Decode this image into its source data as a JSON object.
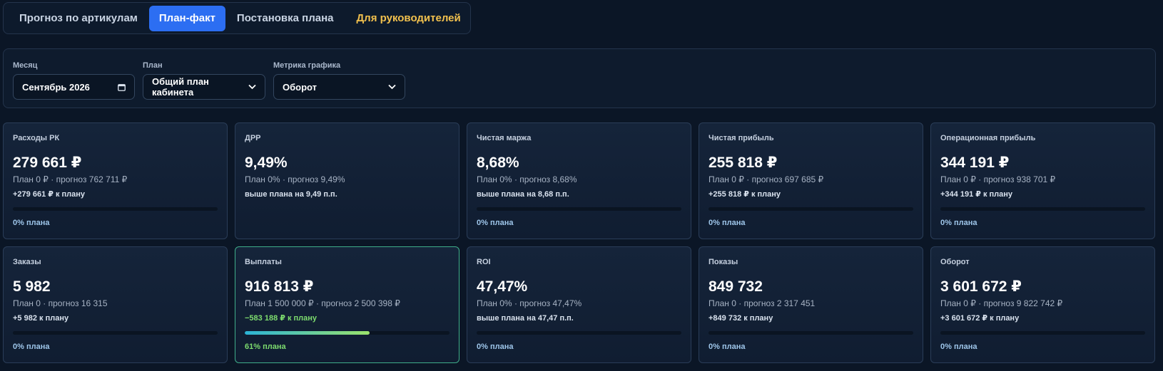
{
  "tabs": [
    {
      "label": "Прогноз по артикулам"
    },
    {
      "label": "План-факт"
    },
    {
      "label": "Постановка плана"
    },
    {
      "label": "Для руководителей"
    }
  ],
  "colors": {
    "active_tab": "#2c6ef2",
    "accent_tab": "#f2c14e",
    "positive": "#7ddc6e"
  },
  "filters": {
    "month": {
      "label": "Месяц",
      "value": "Сентябрь 2026",
      "icon": "calendar-icon"
    },
    "plan": {
      "label": "План",
      "value": "Общий план кабинета",
      "icon": "chevron-down-icon"
    },
    "metric": {
      "label": "Метрика графика",
      "value": "Оборот",
      "icon": "chevron-down-icon"
    }
  },
  "cards": [
    {
      "title": "Расходы РК",
      "value": "279 661 ₽",
      "sub": "План 0 ₽ · прогноз 762 711 ₽",
      "delta": "+279 661 ₽ к плану",
      "pct": "0% плана",
      "progress": 0
    },
    {
      "title": "ДРР",
      "value": "9,49%",
      "sub": "План 0% · прогноз 9,49%",
      "delta": "выше плана на 9,49 п.п."
    },
    {
      "title": "Чистая маржа",
      "value": "8,68%",
      "sub": "План 0% · прогноз 8,68%",
      "delta": "выше плана на 8,68 п.п.",
      "pct": "0% плана",
      "progress": 0
    },
    {
      "title": "Чистая прибыль",
      "value": "255 818 ₽",
      "sub": "План 0 ₽ · прогноз 697 685 ₽",
      "delta": "+255 818 ₽ к плану",
      "pct": "0% плана",
      "progress": 0
    },
    {
      "title": "Операционная прибыль",
      "value": "344 191 ₽",
      "sub": "План 0 ₽ · прогноз 938 701 ₽",
      "delta": "+344 191 ₽ к плану",
      "pct": "0% плана",
      "progress": 0
    },
    {
      "title": "Заказы",
      "value": "5 982",
      "sub": "План 0 · прогноз 16 315",
      "delta": "+5 982 к плану",
      "pct": "0% плана",
      "progress": 0
    },
    {
      "title": "Выплаты",
      "value": "916 813 ₽",
      "sub": "План 1 500 000 ₽ · прогноз 2 500 398 ₽",
      "delta": "−583 188 ₽ к плану",
      "pct": "61% плана",
      "progress": 0.61
    },
    {
      "title": "ROI",
      "value": "47,47%",
      "sub": "План 0% · прогноз 47,47%",
      "delta": "выше плана на 47,47 п.п.",
      "pct": "0% плана",
      "progress": 0
    },
    {
      "title": "Показы",
      "value": "849 732",
      "sub": "План 0 · прогноз 2 317 451",
      "delta": "+849 732 к плану",
      "pct": "0% плана",
      "progress": 0
    },
    {
      "title": "Оборот",
      "value": "3 601 672 ₽",
      "sub": "План 0 ₽ · прогноз 9 822 742 ₽",
      "delta": "+3 601 672 ₽ к плану",
      "pct": "0% плана",
      "progress": 0
    }
  ]
}
